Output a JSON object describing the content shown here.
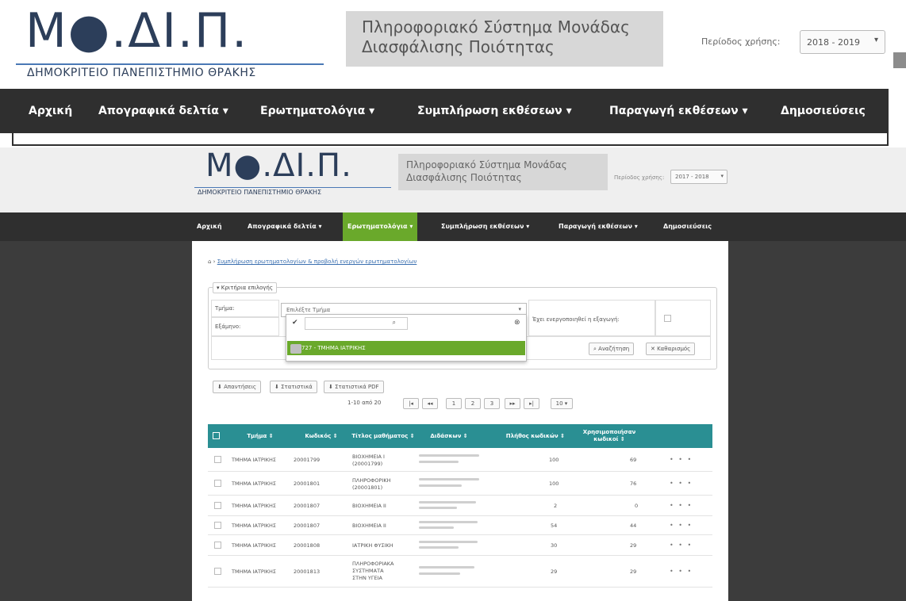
{
  "outer": {
    "logo_text": "Μ●.ΔΙ.Π.",
    "logo_sub": "ΔΗΜΟΚΡΙΤΕΙΟ ΠΑΝΕΠΙΣΤΗΜΙΟ ΘΡΑΚΗΣ",
    "system_title_line1": "Πληροφοριακό Σύστημα Μονάδας",
    "system_title_line2": "Διασφάλισης Ποιότητας",
    "period_label": "Περίοδος χρήσης:",
    "period_value": "2018 - 2019",
    "nav": [
      "Αρχική",
      "Απογραφικά δελτία ▾",
      "Ερωτηματολόγια ▾",
      "Συμπλήρωση εκθέσεων ▾",
      "Παραγωγή εκθέσεων ▾",
      "Δημοσιεύσεις"
    ]
  },
  "inner": {
    "logo_text": "Μ●.ΔΙ.Π.",
    "logo_sub": "ΔΗΜΟΚΡΙΤΕΙΟ ΠΑΝΕΠΙΣΤΗΜΙΟ ΘΡΑΚΗΣ",
    "system_title_line1": "Πληροφοριακό Σύστημα Μονάδας",
    "system_title_line2": "Διασφάλισης Ποιότητας",
    "period_label": "Περίοδος χρήσης:",
    "period_value": "2017 - 2018",
    "nav": [
      "Αρχική",
      "Απογραφικά δελτία ▾",
      "Ερωτηματολόγια ▾",
      "Συμπλήρωση εκθέσεων ▾",
      "Παραγωγή εκθέσεων ▾",
      "Δημοσιεύσεις"
    ],
    "breadcrumb": "Συμπλήρωση ερωτηματολογίων & προβολή ενεργών ερωτηματολογίων",
    "criteria": {
      "legend": "Κριτήρια επιλογής",
      "dept_label": "Τμήμα:",
      "dept_placeholder": "Επιλέξτε Τμήμα",
      "semester_label": "Εξάμηνο:",
      "active_label": "Έχει ενεργοποιηθεί η εξαγωγή:",
      "option": "727 - ΤΜΗΜΑ ΙΑΤΡΙΚΗΣ",
      "search_btn": "Αναζήτηση",
      "clear_btn": "Καθαρισμός"
    },
    "actions": [
      "Απαντήσεις",
      "Στατιστικά",
      "Στατιστικά PDF"
    ],
    "pager": {
      "info": "1-10 από 20",
      "first": "|◂",
      "prev": "◂◂",
      "pages": [
        "1",
        "2",
        "3"
      ],
      "next": "▸▸",
      "last": "▸|",
      "size": "10 ▾"
    },
    "grid": {
      "headers": [
        "Τμήμα ⇕",
        "Κωδικός ⇕",
        "Τίτλος μαθήματος ⇕",
        "Διδάσκων ⇕",
        "Πλήθος κωδικών ⇕",
        "Χρησιμοποιήσαν κωδικοί ⇕"
      ],
      "rows": [
        {
          "dept": "ΤΜΗΜΑ ΙΑΤΡΙΚΗΣ",
          "code": "20001799",
          "title": [
            "ΒΙΟΧΗΜΕΙΑ Ι",
            "(20001799)"
          ],
          "total": "100",
          "used": "69"
        },
        {
          "dept": "ΤΜΗΜΑ ΙΑΤΡΙΚΗΣ",
          "code": "20001801",
          "title": [
            "ΠΛΗΡΟΦΟΡΙΚΗ",
            "(20001801)"
          ],
          "total": "100",
          "used": "76"
        },
        {
          "dept": "ΤΜΗΜΑ ΙΑΤΡΙΚΗΣ",
          "code": "20001807",
          "title": [
            "ΒΙΟΧΗΜΕΙΑ ΙΙ"
          ],
          "total": "2",
          "used": "0"
        },
        {
          "dept": "ΤΜΗΜΑ ΙΑΤΡΙΚΗΣ",
          "code": "20001807",
          "title": [
            "ΒΙΟΧΗΜΕΙΑ ΙΙ"
          ],
          "total": "54",
          "used": "44"
        },
        {
          "dept": "ΤΜΗΜΑ ΙΑΤΡΙΚΗΣ",
          "code": "20001808",
          "title": [
            "ΙΑΤΡΙΚΗ ΦΥΣΙΚΗ"
          ],
          "total": "30",
          "used": "29"
        },
        {
          "dept": "ΤΜΗΜΑ ΙΑΤΡΙΚΗΣ",
          "code": "20001813",
          "title": [
            "ΠΛΗΡΟΦΟΡΙΑΚΑ",
            "ΣΥΣΤΗΜΑΤΑ",
            "ΣΤΗΝ ΥΓΕΙΑ"
          ],
          "total": "29",
          "used": "29"
        }
      ]
    },
    "row_menu": "• • •"
  },
  "colors": {
    "nav_bg": "#2f2f2f",
    "active_green": "#6aa92b",
    "grid_header": "#2a8f93",
    "side_dark": "#3c3c3c"
  }
}
